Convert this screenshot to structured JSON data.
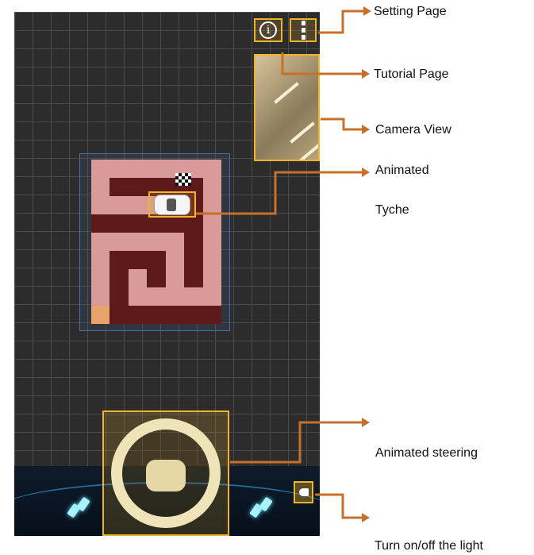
{
  "annotations": {
    "setting": "Setting Page",
    "tutorial": "Tutorial Page",
    "camera": "Camera View",
    "animated": "Animated",
    "tyche": "Tyche",
    "steering": "Animated steering",
    "light": "Turn on/off the light"
  },
  "buttons": {
    "info": "i"
  },
  "colors": {
    "highlight": "#f0b429",
    "arrow": "#c8702a",
    "maze_wall": "#5e1a1a",
    "maze_path": "#d99a9a",
    "grid_bg": "#2c2c2c"
  },
  "icons": [
    "info-icon",
    "menu-icon",
    "car-icon",
    "finish-flag-icon",
    "steering-wheel-icon",
    "headlight-icon",
    "pedal-icon"
  ]
}
